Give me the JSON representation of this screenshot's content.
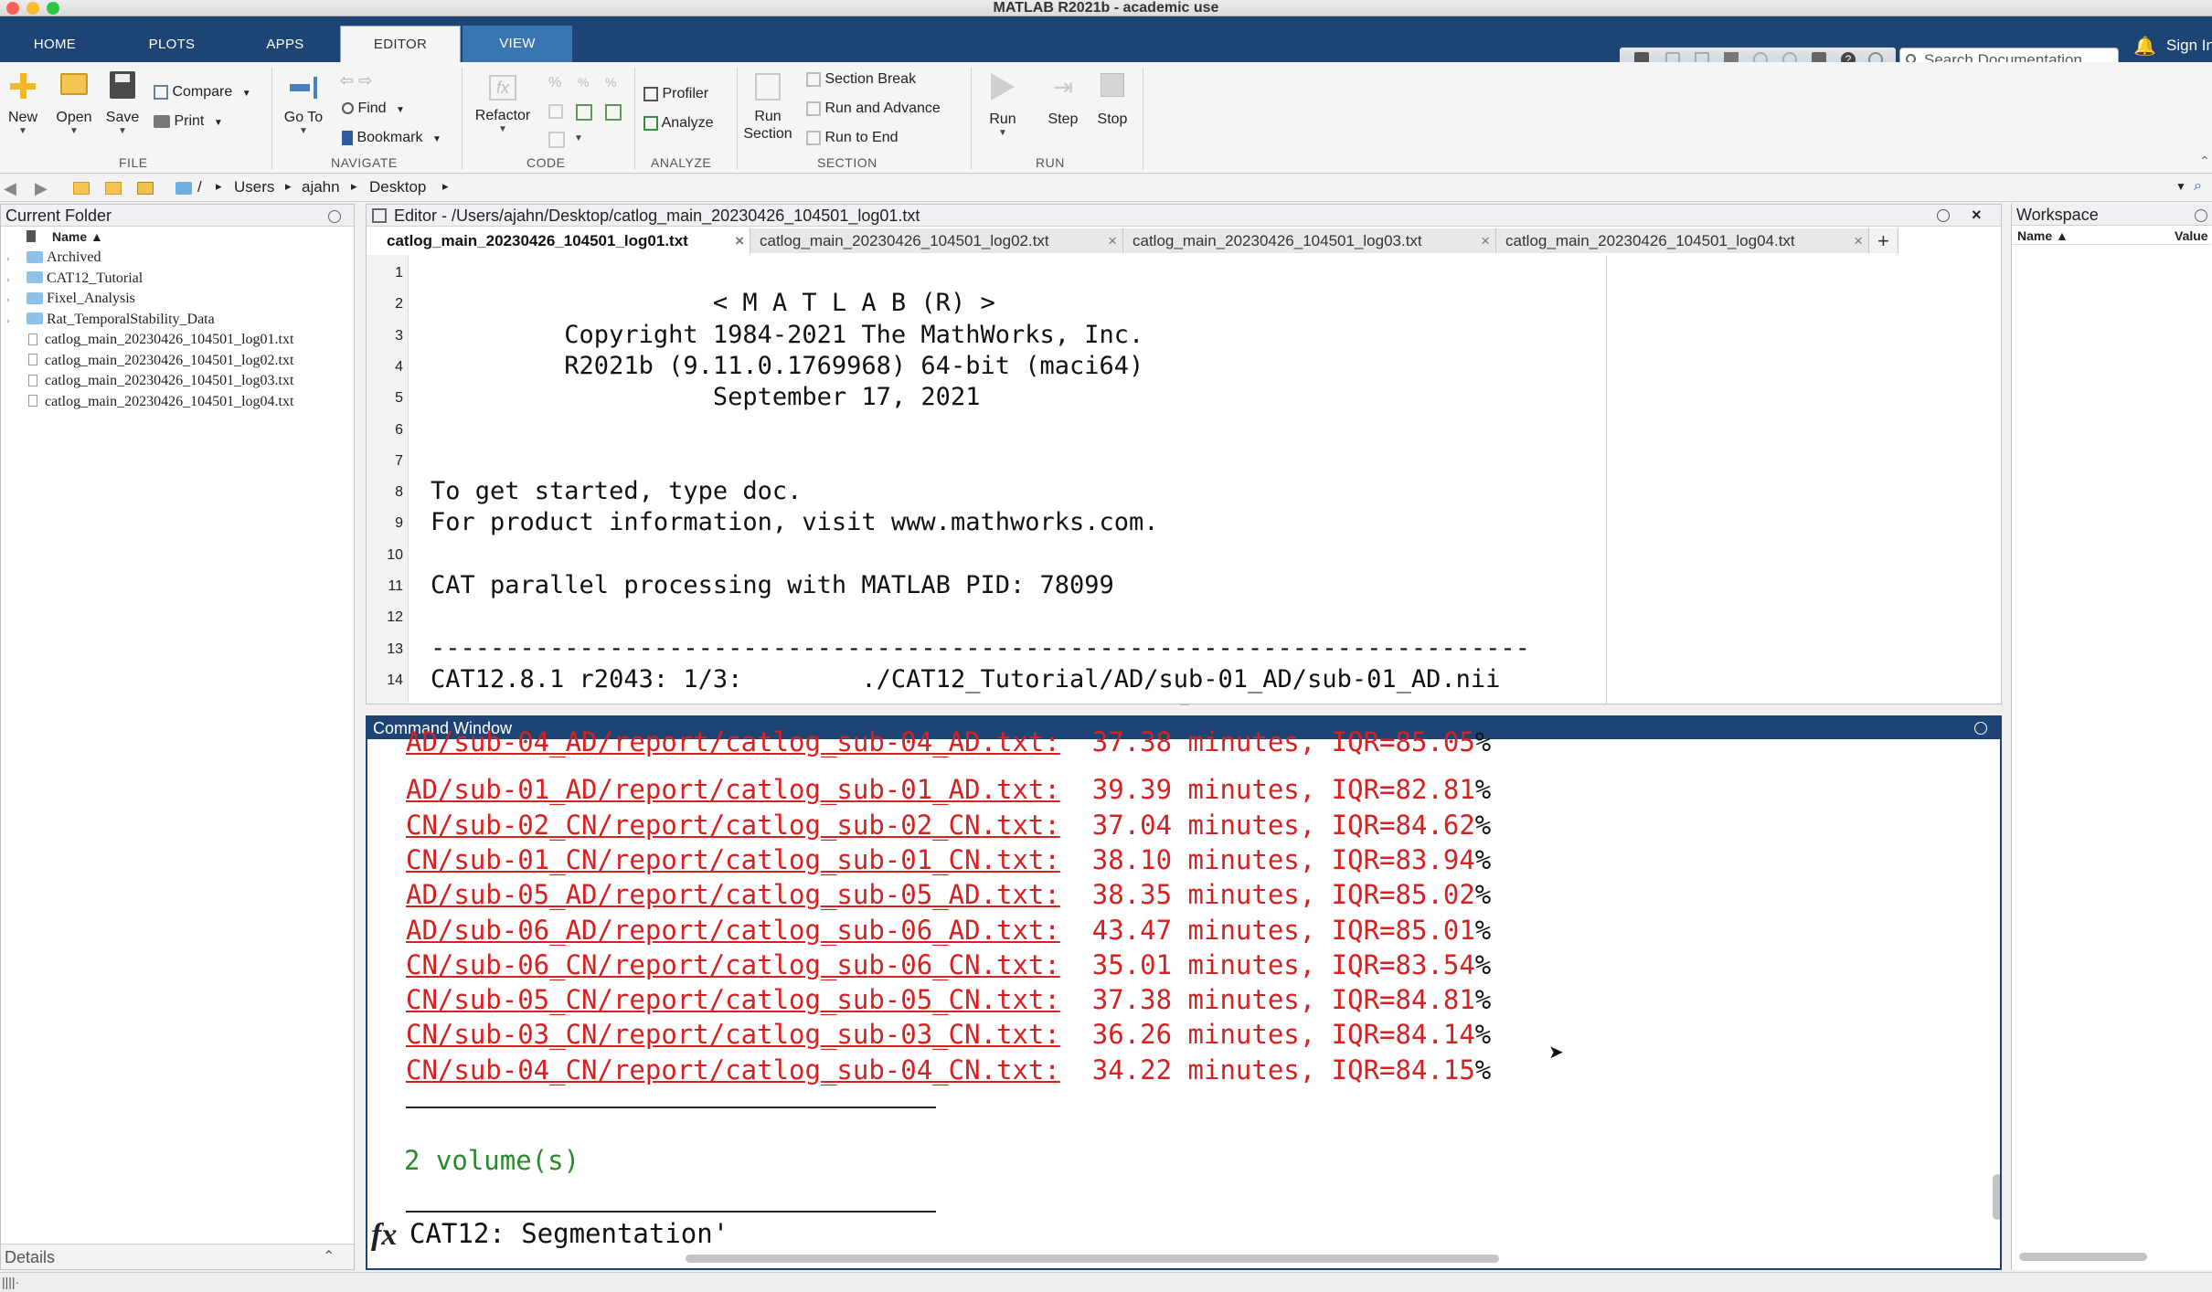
{
  "window": {
    "title": "MATLAB R2021b - academic use",
    "traffic_colors": [
      "#ff5f57",
      "#febc2e",
      "#28c840"
    ]
  },
  "main_tabs": {
    "home": "HOME",
    "plots": "PLOTS",
    "apps": "APPS",
    "editor": "EDITOR",
    "view": "VIEW"
  },
  "header": {
    "search_placeholder": "Search Documentation",
    "sign_in": "Sign In"
  },
  "ribbon": {
    "file": {
      "group": "FILE",
      "new": "New",
      "open": "Open",
      "save": "Save",
      "compare": "Compare",
      "print": "Print"
    },
    "navigate": {
      "group": "NAVIGATE",
      "go_to": "Go To",
      "find": "Find",
      "bookmark": "Bookmark"
    },
    "code": {
      "group": "CODE",
      "refactor": "Refactor"
    },
    "analyze": {
      "group": "ANALYZE",
      "profiler": "Profiler",
      "analyze": "Analyze"
    },
    "section": {
      "group": "SECTION",
      "run_section_1": "Run",
      "run_section_2": "Section",
      "section_break": "Section Break",
      "run_and_advance": "Run and Advance",
      "run_to_end": "Run to End"
    },
    "run": {
      "group": "RUN",
      "run": "Run",
      "step": "Step",
      "stop": "Stop"
    }
  },
  "path": {
    "root": "/",
    "segments": [
      "Users",
      "ajahn",
      "Desktop"
    ]
  },
  "current_folder": {
    "title": "Current Folder",
    "column": "Name ▲",
    "folders": [
      "Archived",
      "CAT12_Tutorial",
      "Fixel_Analysis",
      "Rat_TemporalStability_Data"
    ],
    "files": [
      "catlog_main_20230426_104501_log01.txt",
      "catlog_main_20230426_104501_log02.txt",
      "catlog_main_20230426_104501_log03.txt",
      "catlog_main_20230426_104501_log04.txt"
    ],
    "details": "Details"
  },
  "editor": {
    "title": "Editor - /Users/ajahn/Desktop/catlog_main_20230426_104501_log01.txt",
    "tabs": [
      "catlog_main_20230426_104501_log01.txt",
      "catlog_main_20230426_104501_log02.txt",
      "catlog_main_20230426_104501_log03.txt",
      "catlog_main_20230426_104501_log04.txt"
    ],
    "add_tab": "+",
    "line_numbers": [
      "1",
      "2",
      "3",
      "4",
      "5",
      "6",
      "7",
      "8",
      "9",
      "10",
      "11",
      "12",
      "13",
      "14"
    ],
    "lines": [
      "",
      "                   < M A T L A B (R) >",
      "         Copyright 1984-2021 The MathWorks, Inc.",
      "         R2021b (9.11.0.1769968) 64-bit (maci64)",
      "                   September 17, 2021",
      "",
      "",
      "To get started, type doc.",
      "For product information, visit www.mathworks.com.",
      "",
      "CAT parallel processing with MATLAB PID: 78099",
      "",
      "--------------------------------------------------------------------------",
      "CAT12.8.1 r2043: 1/3:        ./CAT12_Tutorial/AD/sub-01_AD/sub-01_AD.nii"
    ]
  },
  "command_window": {
    "title": "Command Window",
    "log_rows": [
      {
        "path": "AD/sub-04_AD/report/catlog_sub-04_AD.txt:",
        "stat": "37.38 minutes, IQR=85.05",
        "pct": "%"
      },
      {
        "path": "AD/sub-01_AD/report/catlog_sub-01_AD.txt:",
        "stat": "39.39 minutes, IQR=82.81",
        "pct": "%"
      },
      {
        "path": "CN/sub-02_CN/report/catlog_sub-02_CN.txt:",
        "stat": "37.04 minutes, IQR=84.62",
        "pct": "%"
      },
      {
        "path": "CN/sub-01_CN/report/catlog_sub-01_CN.txt:",
        "stat": "38.10 minutes, IQR=83.94",
        "pct": "%"
      },
      {
        "path": "AD/sub-05_AD/report/catlog_sub-05_AD.txt:",
        "stat": "38.35 minutes, IQR=85.02",
        "pct": "%"
      },
      {
        "path": "AD/sub-06_AD/report/catlog_sub-06_AD.txt:",
        "stat": "43.47 minutes, IQR=85.01",
        "pct": "%"
      },
      {
        "path": "CN/sub-06_CN/report/catlog_sub-06_CN.txt:",
        "stat": "35.01 minutes, IQR=83.54",
        "pct": "%"
      },
      {
        "path": "CN/sub-05_CN/report/catlog_sub-05_CN.txt:",
        "stat": "37.38 minutes, IQR=84.81",
        "pct": "%"
      },
      {
        "path": "CN/sub-03_CN/report/catlog_sub-03_CN.txt:",
        "stat": "36.26 minutes, IQR=84.14",
        "pct": "%"
      },
      {
        "path": "CN/sub-04_CN/report/catlog_sub-04_CN.txt:",
        "stat": "34.22 minutes, IQR=84.15",
        "pct": "%"
      }
    ],
    "volume_line": "2 volume(s)",
    "prompt_symbol": "fx",
    "prompt_text": "CAT12: Segmentation'"
  },
  "workspace": {
    "title": "Workspace",
    "col_name": "Name ▲",
    "col_value": "Value"
  },
  "status": {
    "text": "||||·"
  },
  "colors": {
    "accent": "#1d4474",
    "error_text": "#d62121",
    "success_text": "#2a8a2a",
    "view_tab": "#3975b3"
  }
}
